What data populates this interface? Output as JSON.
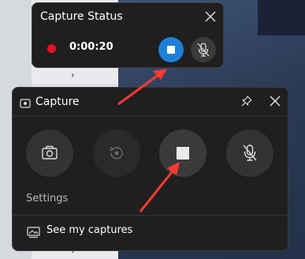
{
  "status_window": {
    "title": "Capture Status",
    "timer": "0:00:20"
  },
  "capture_window": {
    "title": "Capture",
    "settings_label": "Settings",
    "see_captures_label": "See my captures"
  },
  "colors": {
    "record_dot": "#e81123",
    "stop_button_active": "#1e7fd7",
    "annotation_arrow": "#ff3b30",
    "window_bg": "#1f1f1f"
  },
  "icons": {
    "status_close": "close-icon",
    "status_stop": "stop-icon",
    "status_mic": "mic-off-icon",
    "capture_header": "capture-widget-icon",
    "capture_pin": "pin-icon",
    "capture_close": "close-icon",
    "screenshot": "camera-icon",
    "record_last": "record-last-icon",
    "stop_recording": "stop-icon",
    "mic_toggle": "mic-off-icon",
    "captures_gallery": "gallery-icon"
  }
}
